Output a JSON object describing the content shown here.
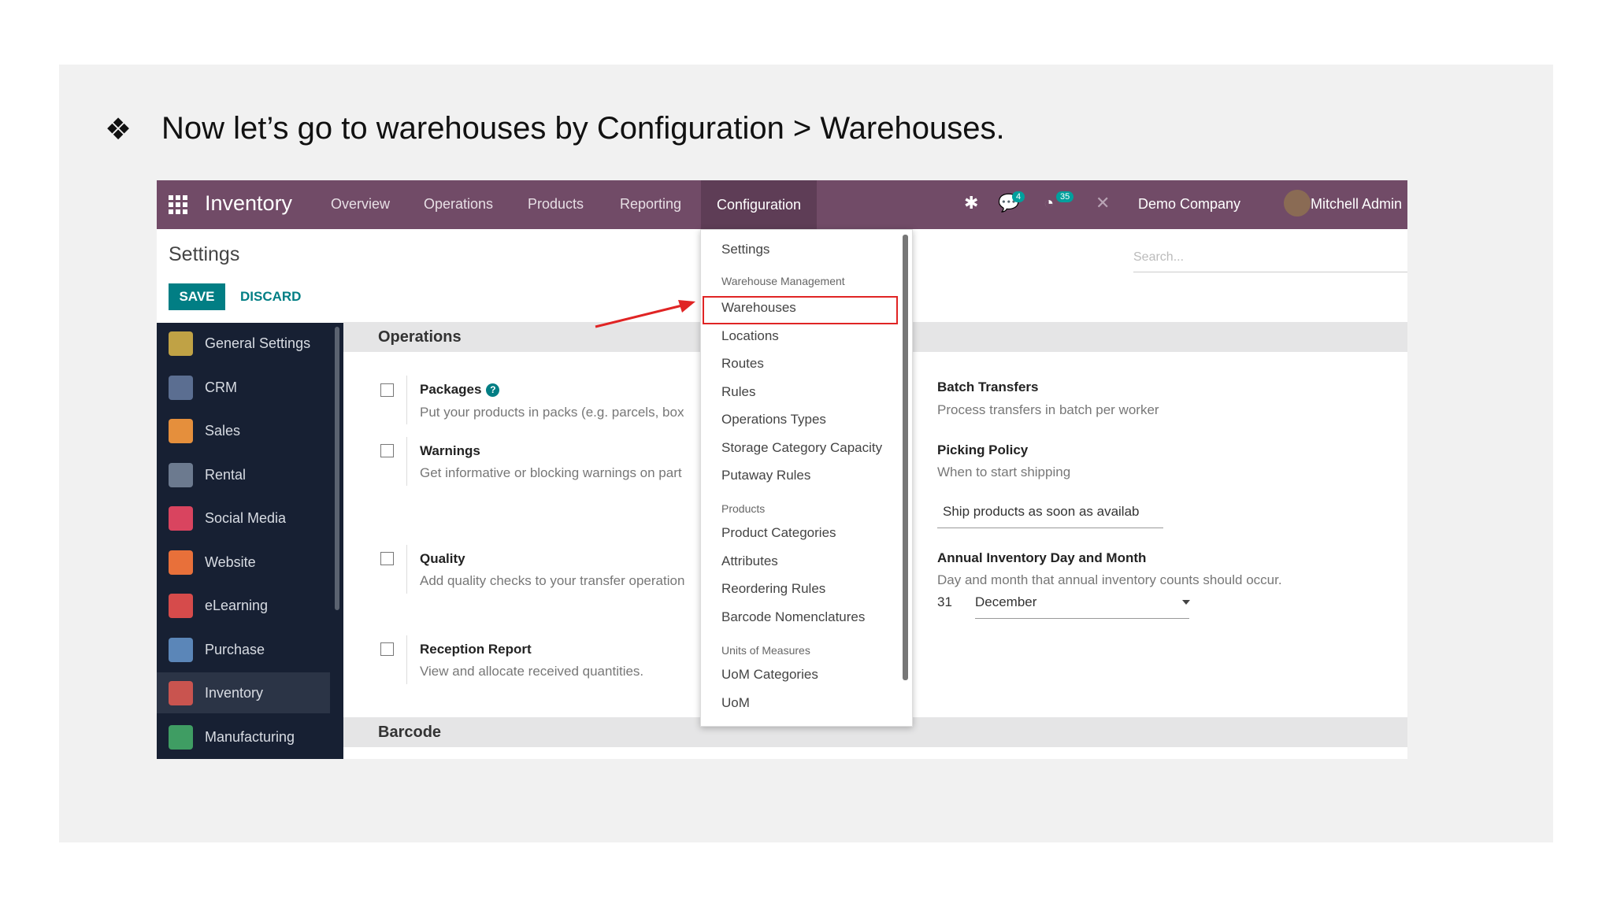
{
  "slide": {
    "bullet": "❖",
    "instruction": "Now let’s go to warehouses by Configuration > Warehouses."
  },
  "topbar": {
    "app_name": "Inventory",
    "nav": [
      "Overview",
      "Operations",
      "Products",
      "Reporting",
      "Configuration"
    ],
    "active_nav": "Configuration",
    "messages_count": "4",
    "activities_count": "35",
    "company": "Demo Company",
    "user": "Mitchell Admin"
  },
  "page": {
    "title": "Settings",
    "save_label": "SAVE",
    "discard_label": "DISCARD",
    "search_placeholder": "Search..."
  },
  "sidebar": {
    "items": [
      {
        "label": "General Settings",
        "color": "#c0a245"
      },
      {
        "label": "CRM",
        "color": "#5b6e91"
      },
      {
        "label": "Sales",
        "color": "#e58f3c"
      },
      {
        "label": "Rental",
        "color": "#6c7a8f"
      },
      {
        "label": "Social Media",
        "color": "#d9445f"
      },
      {
        "label": "Website",
        "color": "#e8703a"
      },
      {
        "label": "eLearning",
        "color": "#d64b4b"
      },
      {
        "label": "Purchase",
        "color": "#5b86b8"
      },
      {
        "label": "Inventory",
        "color": "#c9544f"
      },
      {
        "label": "Manufacturing",
        "color": "#3f9d63"
      }
    ],
    "active": "Inventory"
  },
  "sections": {
    "operations": "Operations",
    "barcode": "Barcode"
  },
  "options_left": [
    {
      "title": "Packages",
      "desc": "Put your products in packs (e.g. parcels, box"
    },
    {
      "title": "Warnings",
      "desc": "Get informative or blocking warnings on part"
    },
    {
      "title": "Quality",
      "desc": "Add quality checks to your transfer operation"
    },
    {
      "title": "Reception Report",
      "desc": "View and allocate received quantities."
    }
  ],
  "options_right": {
    "batch": {
      "title": "Batch Transfers",
      "desc": "Process transfers in batch per worker"
    },
    "picking": {
      "title": "Picking Policy",
      "desc": "When to start shipping",
      "value": "Ship products as soon as availab"
    },
    "annual": {
      "title": "Annual Inventory Day and Month",
      "desc": "Day and month that annual inventory counts should occur.",
      "day": "31",
      "month": "December"
    }
  },
  "config_menu": {
    "settings": "Settings",
    "group_warehouse": "Warehouse Management",
    "warehouse_items": [
      "Warehouses",
      "Locations",
      "Routes",
      "Rules",
      "Operations Types",
      "Storage Category Capacity",
      "Putaway Rules"
    ],
    "group_products": "Products",
    "product_items": [
      "Product Categories",
      "Attributes",
      "Reordering Rules",
      "Barcode Nomenclatures"
    ],
    "group_uom": "Units of Measures",
    "uom_items": [
      "UoM Categories",
      "UoM"
    ],
    "highlighted": "Warehouses"
  },
  "colors": {
    "brand": "#714b67",
    "primary": "#017e84",
    "highlight": "#e02424"
  }
}
